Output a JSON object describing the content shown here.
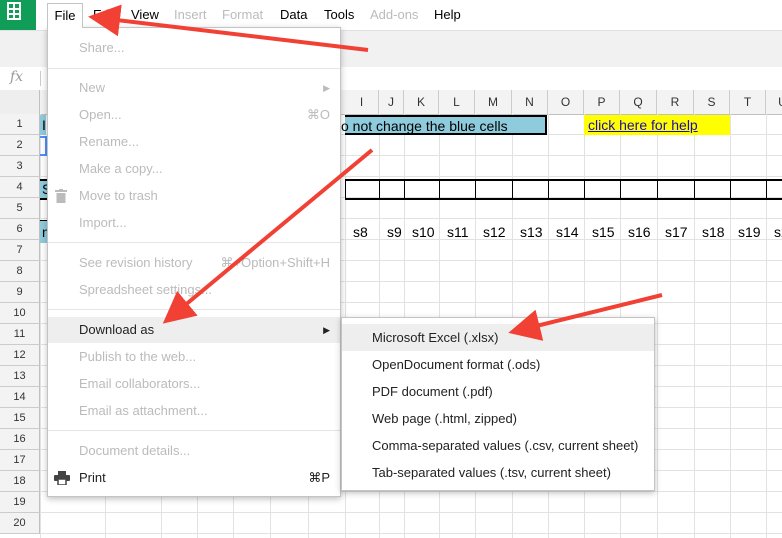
{
  "menubar": {
    "items": [
      {
        "label": "File",
        "enabled": true
      },
      {
        "label": "Edit",
        "enabled": true
      },
      {
        "label": "View",
        "enabled": true
      },
      {
        "label": "Insert",
        "enabled": false
      },
      {
        "label": "Format",
        "enabled": false
      },
      {
        "label": "Data",
        "enabled": true
      },
      {
        "label": "Tools",
        "enabled": true
      },
      {
        "label": "Add-ons",
        "enabled": false
      },
      {
        "label": "Help",
        "enabled": true
      }
    ]
  },
  "formula_bar": {
    "fx_label": "fx"
  },
  "columns": [
    "I",
    "J",
    "K",
    "L",
    "M",
    "N",
    "O",
    "P",
    "Q",
    "R",
    "S",
    "T",
    "U"
  ],
  "rows": [
    "1",
    "2",
    "3",
    "4",
    "5",
    "6",
    "7",
    "8",
    "9",
    "10",
    "11",
    "12",
    "13",
    "14",
    "15",
    "16",
    "17",
    "18",
    "19",
    "20"
  ],
  "cells": {
    "row1_text": "o not change the blue cells",
    "help_link": "click here for help",
    "row1_left": "I",
    "row4_left": "S",
    "row6_left": "n",
    "row6_values": [
      "s8",
      "s9",
      "s10",
      "s11",
      "s12",
      "s13",
      "s14",
      "s15",
      "s16",
      "s17",
      "s18",
      "s19",
      "s2"
    ]
  },
  "file_menu": {
    "share": "Share...",
    "new": "New",
    "open": "Open...",
    "open_shortcut": "⌘O",
    "rename": "Rename...",
    "make_copy": "Make a copy...",
    "move_to_trash": "Move to trash",
    "import": "Import...",
    "revision_history": "See revision history",
    "revision_shortcut": "⌘+Option+Shift+H",
    "spreadsheet_settings": "Spreadsheet settings...",
    "download_as": "Download as",
    "publish": "Publish to the web...",
    "email_collaborators": "Email collaborators...",
    "email_attachment": "Email as attachment...",
    "document_details": "Document details...",
    "print": "Print",
    "print_shortcut": "⌘P"
  },
  "download_submenu": {
    "items": [
      "Microsoft Excel (.xlsx)",
      "OpenDocument format (.ods)",
      "PDF document (.pdf)",
      "Web page (.html, zipped)",
      "Comma-separated values (.csv, current sheet)",
      "Tab-separated values (.tsv, current sheet)"
    ]
  },
  "colors": {
    "sheets_green": "#0f9d58",
    "blue_cells": "#8ecbdc",
    "yellow_cell": "#ffff00",
    "annotation_arrow": "#f04134"
  }
}
